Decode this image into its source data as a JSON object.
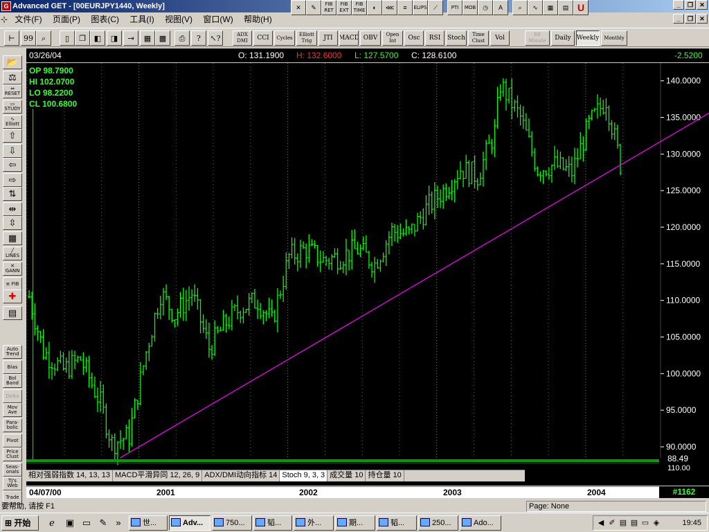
{
  "window": {
    "title": "Advanced GET - [00EURJPY1440, Weekly]"
  },
  "menu": [
    "文件(F)",
    "页面(P)",
    "图表(C)",
    "工具(I)",
    "视图(V)",
    "窗口(W)",
    "帮助(H)"
  ],
  "draw_toolbar": [
    {
      "name": "cross-icon",
      "glyph": "✕"
    },
    {
      "name": "pencil-icon",
      "glyph": "✎"
    },
    {
      "name": "fib-ret-button",
      "glyph": "FIB RET"
    },
    {
      "name": "fib-ext-button",
      "glyph": "FIB EXT"
    },
    {
      "name": "fib-time-button",
      "glyph": "FIB TIME"
    },
    {
      "name": "fib-circle-icon",
      "glyph": "◐"
    },
    {
      "name": "fan-lines-icon",
      "glyph": "⋘"
    },
    {
      "name": "regression-icon",
      "glyph": "≡"
    },
    {
      "name": "elips-button",
      "glyph": "ELIPS"
    },
    {
      "name": "diagonal-icon",
      "glyph": "⟋"
    },
    {
      "name": "pti-button",
      "glyph": "PTI"
    },
    {
      "name": "mob-button",
      "glyph": "MOB"
    },
    {
      "name": "clock-icon",
      "glyph": "◷"
    },
    {
      "name": "text-tool-button",
      "glyph": "A"
    },
    {
      "name": "zoom-icon",
      "glyph": "⌕"
    },
    {
      "name": "snake-icon",
      "glyph": "∿"
    },
    {
      "name": "grid-icon",
      "glyph": "▦"
    },
    {
      "name": "notes-icon",
      "glyph": "▤"
    },
    {
      "name": "magnet-icon",
      "glyph": "U"
    }
  ],
  "indicator_toolbar": {
    "icons": [
      {
        "name": "pin-icon",
        "glyph": "⊢"
      },
      {
        "name": "quote-icon",
        "glyph": "99"
      },
      {
        "name": "search-icon",
        "glyph": "⌕"
      },
      {
        "name": "new-page-icon",
        "glyph": "▯"
      },
      {
        "name": "copy-icon",
        "glyph": "❐"
      },
      {
        "name": "chart-left-icon",
        "glyph": "◧"
      },
      {
        "name": "chart-right-icon",
        "glyph": "◨"
      },
      {
        "name": "export-icon",
        "glyph": "⇥"
      },
      {
        "name": "grid-off-icon",
        "glyph": "▦"
      },
      {
        "name": "grid-on-icon",
        "glyph": "▩"
      },
      {
        "name": "print-icon",
        "glyph": "⎙"
      },
      {
        "name": "help-icon",
        "glyph": "?"
      },
      {
        "name": "context-help-icon",
        "glyph": "↖?"
      }
    ],
    "studies": [
      "ADX DMI",
      "CCI",
      "Cycles",
      "Elliott Trig",
      "JTI",
      "MACD",
      "OBV",
      "Open Int",
      "Osc",
      "RSI",
      "Stoch",
      "Time Clust",
      "Vol"
    ],
    "periods": [
      "60 Minute",
      "Daily",
      "Weekly",
      "Monthly"
    ],
    "active_period": "Weekly"
  },
  "info": {
    "date": "03/26/04",
    "open": "O: 131.1900",
    "high": "H: 132.6000",
    "low": "L: 127.5700",
    "close": "C: 128.6100",
    "change": "-2.5200"
  },
  "ohlc_panel": {
    "op": "OP 98.7900",
    "hi": "HI  102.0700",
    "lo": "LO 98.2200",
    "cl": "CL  100.6800"
  },
  "left_toolbar": [
    {
      "name": "open-folder-icon",
      "label": "📂"
    },
    {
      "name": "scales-icon",
      "label": "⚖"
    },
    {
      "name": "reset-button",
      "label": "⇔ RESET"
    },
    {
      "name": "study-button",
      "label": "▭ STUDY"
    },
    {
      "name": "elliott-button",
      "label": "∿ Elliott"
    },
    {
      "name": "arrow-up-icon",
      "label": "⇧"
    },
    {
      "name": "arrow-down-icon",
      "label": "⇩"
    },
    {
      "name": "arrow-left-icon",
      "label": "⇦"
    },
    {
      "name": "arrow-right-icon",
      "label": "⇨"
    },
    {
      "name": "compress-v-icon",
      "label": "⇅"
    },
    {
      "name": "compress-h-icon",
      "label": "⇹"
    },
    {
      "name": "expand-v-icon",
      "label": "⇳"
    },
    {
      "name": "grid-icon",
      "label": "▦"
    },
    {
      "name": "lines-button",
      "label": "╱ LINES"
    },
    {
      "name": "gann-button",
      "label": "✕ GANN"
    },
    {
      "name": "fib-button",
      "label": "≡ FIB"
    },
    {
      "name": "crosshair-icon",
      "label": "✚"
    },
    {
      "name": "page-icon",
      "label": "▤"
    },
    {
      "name": "auto-trend-button",
      "label": "Auto Trend"
    },
    {
      "name": "bias-button",
      "label": "Bias"
    },
    {
      "name": "bol-band-button",
      "label": "Bol Band"
    },
    {
      "name": "delta-button",
      "label": "Delta"
    },
    {
      "name": "mov-ave-button",
      "label": "Mov Ave"
    },
    {
      "name": "parabolic-button",
      "label": "Para- bolic"
    },
    {
      "name": "pivot-button",
      "label": "Pivot"
    },
    {
      "name": "price-clust-button",
      "label": "Price Clust"
    },
    {
      "name": "seasonals-button",
      "label": "Seas- onals"
    },
    {
      "name": "tjs-web-button",
      "label": "TJ's Web"
    },
    {
      "name": "trade-button",
      "label": "Trade"
    }
  ],
  "indicator_tabs": [
    "相对强弱指数 14, 13, 13",
    "MACD平滑异同 12, 26, 9",
    "ADX/DMI动向指标 14",
    "Stoch 9, 3, 3",
    "成交量 10",
    "持仓量 10"
  ],
  "active_indicator_tab": "Stoch 9, 3, 3",
  "tab_overlay_label": "Stoch 9, 3, 3",
  "date_axis": {
    "start": "04/07/00",
    "labels": [
      "2001",
      "2002",
      "2003",
      "2004"
    ]
  },
  "bar_count": "#1162",
  "low_marker": "88.49",
  "lower_panel_value": "110.00",
  "status": {
    "help": "要帮助, 请按 F1",
    "page": "Page: None"
  },
  "taskbar": {
    "start": "开始",
    "tasks": [
      "世...",
      "Adv...",
      "750...",
      "韬...",
      "外...",
      "期...",
      "韬...",
      "250...",
      "Ado..."
    ],
    "active_task": "Adv...",
    "clock": "19:45"
  },
  "colors": {
    "candle": "#00ff00",
    "trendline": "#ff00ff",
    "chart_bg": "#000000"
  },
  "chart_data": {
    "type": "line",
    "title": "",
    "xlabel": "",
    "ylabel": "",
    "x_start": "04/07/00",
    "x_end": "03/26/04",
    "ylim": [
      88,
      142
    ],
    "yticks": [
      90.0,
      95.0,
      100.0,
      105.0,
      110.0,
      115.0,
      120.0,
      125.0,
      130.0,
      135.0,
      140.0
    ],
    "ytick_labels": [
      "90.0000",
      "95.0000",
      "100.0000",
      "105.0000",
      "110.0000",
      "115.0000",
      "120.0000",
      "125.0000",
      "130.0000",
      "135.0000",
      "140.0000"
    ],
    "series": [
      {
        "x": [
          "2000-04-07",
          "2000-05-12",
          "2000-06-30",
          "2000-08-11",
          "2000-09-29",
          "2000-10-27",
          "2000-12-08",
          "2001-01-19",
          "2001-02-23",
          "2001-03-30",
          "2001-05-11",
          "2001-06-22",
          "2001-08-03",
          "2001-09-07",
          "2001-10-19",
          "2001-11-23",
          "2002-01-04",
          "2002-02-15",
          "2002-03-29",
          "2002-05-10",
          "2002-06-21",
          "2002-08-02",
          "2002-09-13",
          "2002-10-25",
          "2002-12-06",
          "2003-01-17",
          "2003-02-28",
          "2003-04-11",
          "2003-05-23",
          "2003-06-06",
          "2003-07-25",
          "2003-09-05",
          "2003-10-17",
          "2003-11-28",
          "2004-01-09",
          "2004-02-20",
          "2004-03-26"
        ],
        "values": [
          110.5,
          103.0,
          100.5,
          102.0,
          96.0,
          90.5,
          91.5,
          103.0,
          111.0,
          108.0,
          111.0,
          103.5,
          107.0,
          109.0,
          110.0,
          107.0,
          116.0,
          117.0,
          115.5,
          116.0,
          117.0,
          115.0,
          119.5,
          119.0,
          122.5,
          125.0,
          128.0,
          127.0,
          133.0,
          139.5,
          135.0,
          128.0,
          128.5,
          127.5,
          134.0,
          137.5,
          128.6
        ]
      }
    ],
    "trendline": {
      "x": [
        "2000-10-27",
        "2004-03-26"
      ],
      "values": [
        88.5,
        128.5
      ]
    },
    "grid": true
  }
}
